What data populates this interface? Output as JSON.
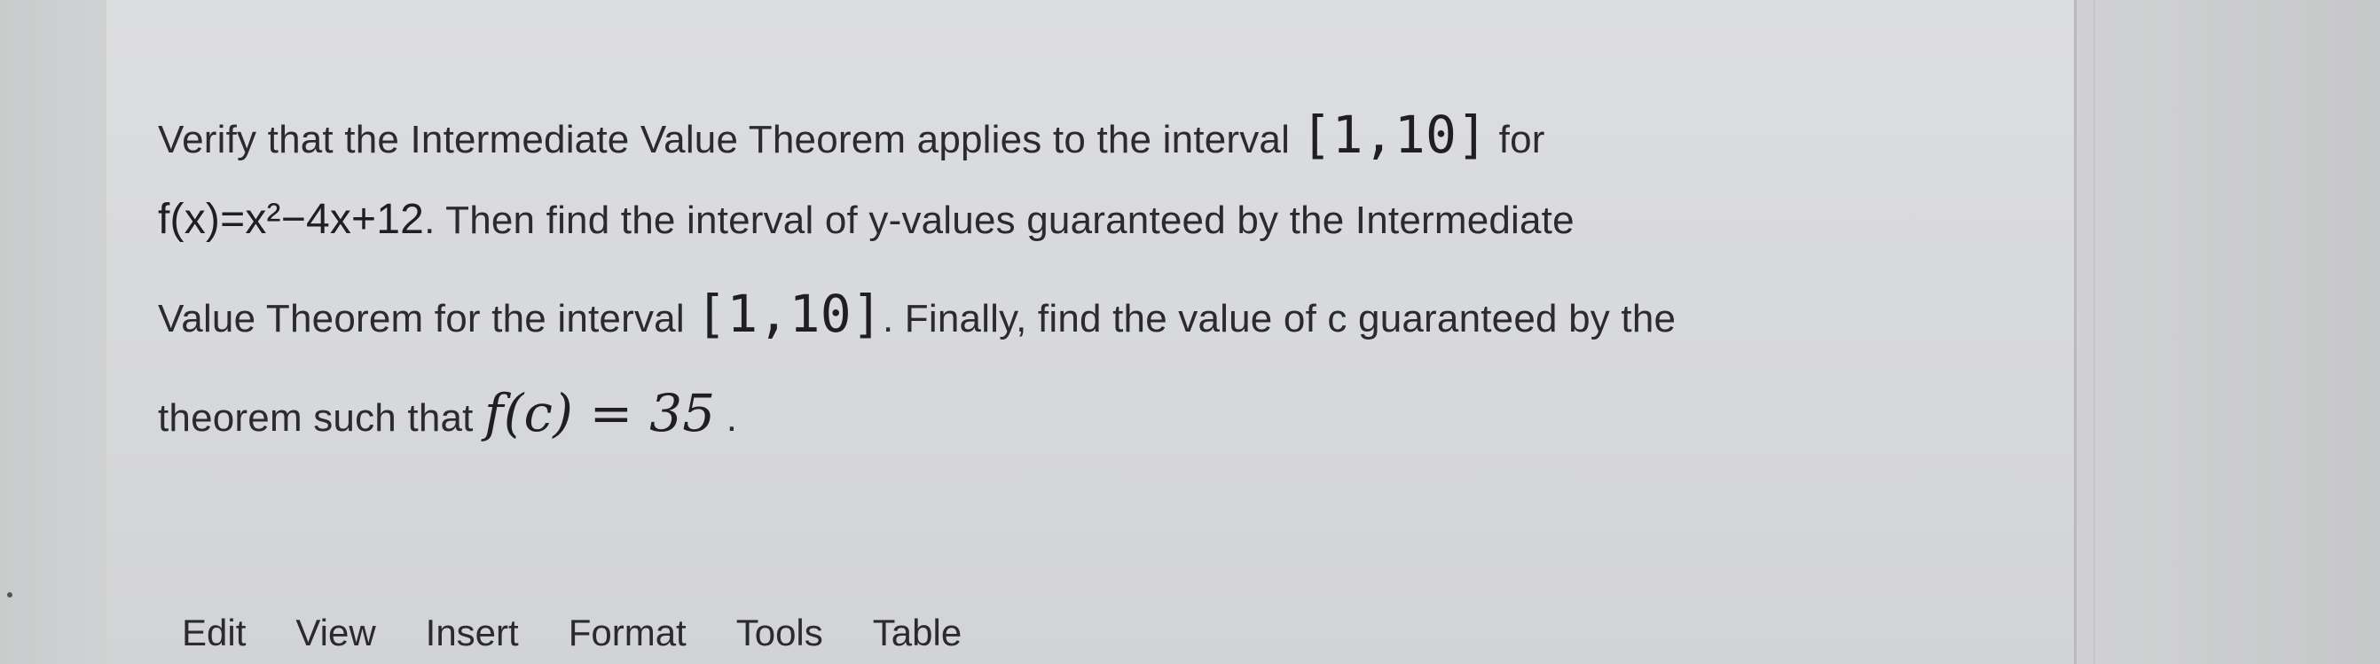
{
  "question": {
    "line1": {
      "text_a": "Verify that the Intermediate Value Theorem applies to the interval",
      "interval": "[1,10]",
      "text_b": "for"
    },
    "line2": {
      "function": "f(x)=x²−4x+12",
      "text": ". Then find the interval of y-values guaranteed by the Intermediate"
    },
    "line3": {
      "text_a": "Value Theorem for the interval",
      "interval": "[1,10]",
      "text_b": ". Finally, find the value of c guaranteed by the"
    },
    "line4": {
      "text_a": "theorem such that",
      "equation": "f(c) = 35",
      "text_b": "."
    }
  },
  "menubar": {
    "items": [
      {
        "label": "Edit"
      },
      {
        "label": "View"
      },
      {
        "label": "Insert"
      },
      {
        "label": "Format"
      },
      {
        "label": "Tools"
      },
      {
        "label": "Table"
      }
    ]
  },
  "colors": {
    "text": "#2b2b2e",
    "page_background": "#dcdddf"
  }
}
